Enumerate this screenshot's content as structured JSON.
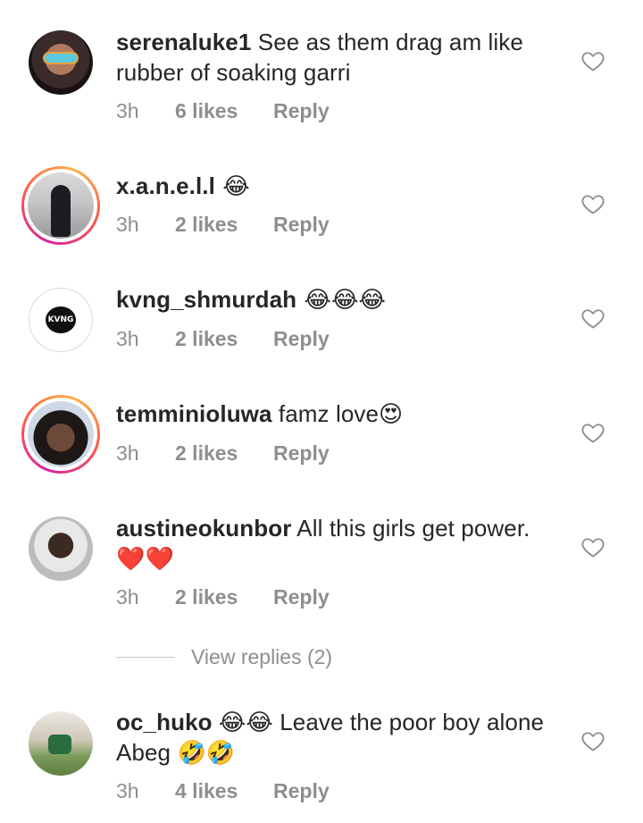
{
  "comments": [
    {
      "username": "serenaluke1",
      "text": " See as them drag am like rubber of soaking garri",
      "time": "3h",
      "likes": "6 likes",
      "reply": "Reply"
    },
    {
      "username": "x.a.n.e.l.l",
      "text": " 😂",
      "time": "3h",
      "likes": "2 likes",
      "reply": "Reply"
    },
    {
      "username": "kvng_shmurdah",
      "text": " 😂😂😂",
      "time": "3h",
      "likes": "2 likes",
      "reply": "Reply"
    },
    {
      "username": "temminioluwa",
      "text": " famz love😍",
      "time": "3h",
      "likes": "2 likes",
      "reply": "Reply"
    },
    {
      "username": "austineokunbor",
      "text": " All this girls get power. ❤️❤️",
      "time": "3h",
      "likes": "2 likes",
      "reply": "Reply"
    },
    {
      "username": "oc_huko",
      "text": " 😂😂 Leave the poor boy alone Abeg 🤣🤣",
      "time": "3h",
      "likes": "4 likes",
      "reply": "Reply"
    }
  ],
  "view_replies": "View replies (2)",
  "kvng_logo_text": "KVNG",
  "colors": {
    "text": "#262626",
    "meta": "#8e8e8e",
    "story_ring": "#d6249f"
  },
  "icons": {
    "like": "heart-outline-icon"
  }
}
